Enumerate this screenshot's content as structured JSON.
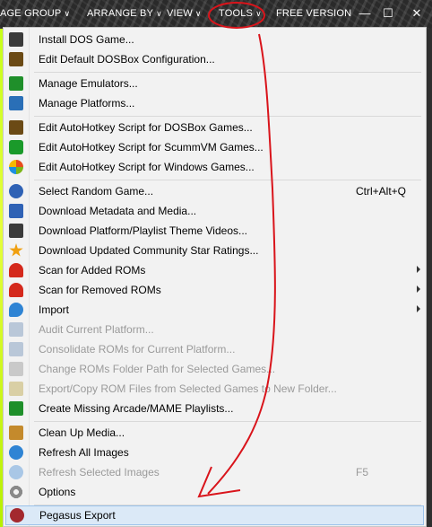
{
  "topbar": {
    "menus": [
      {
        "label": "AGE GROUP",
        "chevron": "chevron-down"
      },
      {
        "label": "ARRANGE BY",
        "chevron": "chevron-down"
      },
      {
        "label": "VIEW",
        "chevron": "chevron-down"
      },
      {
        "label": "TOOLS",
        "chevron": "chevron-down"
      },
      {
        "label": "FREE VERSION"
      }
    ],
    "window_buttons": {
      "minimize": "—",
      "maximize": "☐",
      "close": "✕"
    }
  },
  "tools_menu": {
    "items": [
      {
        "label": "Install DOS Game...",
        "icon": "dos-terminal-icon",
        "color": "#3b3b3b"
      },
      {
        "label": "Edit Default DOSBox Configuration...",
        "icon": "dosbox-icon",
        "color": "#6b4a15"
      },
      {
        "label": "Manage Emulators...",
        "icon": "circuit-chip-icon",
        "color": "#1f8f2a"
      },
      {
        "label": "Manage Platforms...",
        "icon": "monitor-icon",
        "color": "#2a6fb7"
      },
      {
        "label": "Edit AutoHotkey Script for DOSBox Games...",
        "icon": "dosbox-icon",
        "color": "#6b4a15"
      },
      {
        "label": "Edit AutoHotkey Script for ScummVM Games...",
        "icon": "scummvm-icon",
        "color": "#1a9a2a"
      },
      {
        "label": "Edit AutoHotkey Script for Windows Games...",
        "icon": "windows-logo-icon",
        "color": "#e84d1c"
      },
      {
        "label": "Select Random Game...",
        "icon": "question-mark-icon",
        "color": "#2f62b5",
        "shortcut": "Ctrl+Alt+Q"
      },
      {
        "label": "Download Metadata and Media...",
        "icon": "download-icon",
        "color": "#2f62b5"
      },
      {
        "label": "Download Platform/Playlist Theme Videos...",
        "icon": "film-strip-icon",
        "color": "#3b3b3b"
      },
      {
        "label": "Download Updated Community Star Ratings...",
        "icon": "star-icon",
        "color": "#f0a010"
      },
      {
        "label": "Scan for Added ROMs",
        "icon": "magnet-icon",
        "color": "#d4281b",
        "submenu": true
      },
      {
        "label": "Scan for Removed ROMs",
        "icon": "magnet-icon",
        "color": "#d4281b",
        "submenu": true
      },
      {
        "label": "Import",
        "icon": "import-arrow-icon",
        "color": "#2f84d4",
        "submenu": true
      },
      {
        "label": "Audit Current Platform...",
        "icon": "audit-list-icon",
        "color": "#b9c7d8",
        "disabled": true
      },
      {
        "label": "Consolidate ROMs for Current Platform...",
        "icon": "consolidate-icon",
        "color": "#b9c7d8",
        "disabled": true
      },
      {
        "label": "Change ROMs Folder Path for Selected Games...",
        "icon": "folder-path-icon",
        "color": "#c9c9c9",
        "disabled": true
      },
      {
        "label": "Export/Copy ROM Files from Selected Games to New Folder...",
        "icon": "export-folder-icon",
        "color": "#d9cfa5",
        "disabled": true
      },
      {
        "label": "Create Missing Arcade/MAME Playlists...",
        "icon": "arcade-invader-icon",
        "color": "#1f8f2a"
      },
      {
        "label": "Clean Up Media...",
        "icon": "broom-icon",
        "color": "#c48a2c"
      },
      {
        "label": "Refresh All Images",
        "icon": "refresh-icon",
        "color": "#2f84d4"
      },
      {
        "label": "Refresh Selected Images",
        "icon": "refresh-icon",
        "color": "#a9c7e6",
        "shortcut": "F5",
        "disabled": true
      },
      {
        "label": "Options",
        "icon": "gear-icon",
        "color": "#8a8a8a"
      },
      {
        "label": "Pegasus Export",
        "icon": "pegasus-logo-icon",
        "color": "#a3282e",
        "highlighted": true
      }
    ]
  },
  "annotation": {
    "color": "#d9141b"
  }
}
